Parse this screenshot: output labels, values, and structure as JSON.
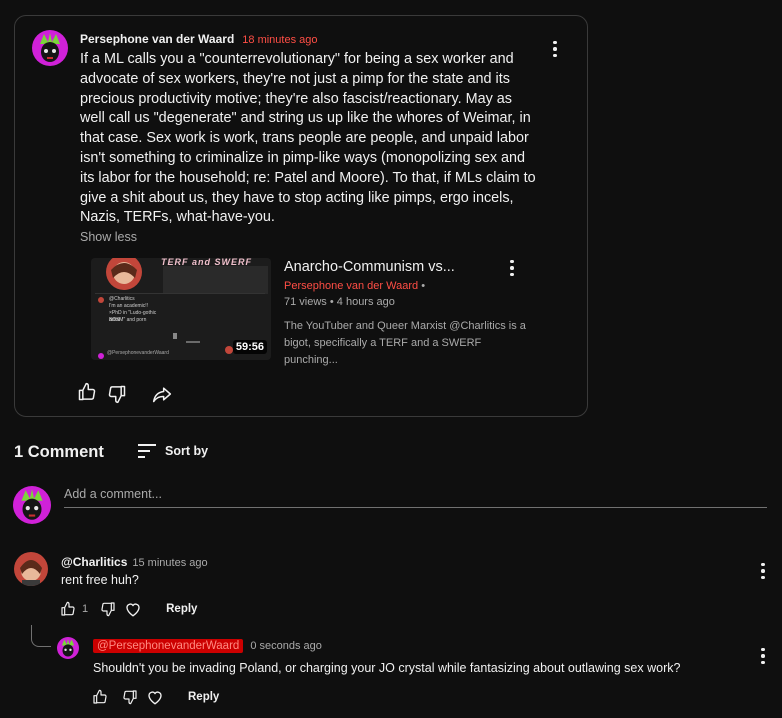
{
  "post": {
    "author": "Persephone van der Waard",
    "time": "18 minutes ago",
    "body": "If a ML calls you a \"counterrevolutionary\" for being a sex worker and advocate of sex workers, they're not just a pimp for the state and its precious productivity motive; they're also fascist/reactionary. May as well call us \"degenerate\" and string us up like the whores of Weimar, in that case. Sex work is work, trans people are people, and unpaid labor isn't something to criminalize in pimp-like ways (monopolizing sex and its labor for the household; re: Patel and Moore). To that, if MLs claim to give a shit about us, they have to stop acting like pimps, ergo incels, Nazis, TERFs, what-have-you.",
    "show_less": "Show less",
    "video": {
      "title": "Anarcho-Communism vs...",
      "channel": "Persephone van der Waard",
      "channel_suffix": "•",
      "views": "71 views",
      "age": "4 hours ago",
      "meta_sep": "•",
      "description": "The YouTuber and Queer Marxist @Charlitics is a bigot, specifically a TERF and a SWERF punching...",
      "duration": "59:56",
      "thumb_banner": "TERF and SWERF",
      "thumb_lines": [
        "@Charlitics",
        "I'm an academic!!",
        "×PhD in \"Ludo-gothic BDSM\" and porn",
        "artist",
        "@PersephonevanderWaard"
      ]
    }
  },
  "comments_header": {
    "count_label": "1 Comment",
    "sort_label": "Sort by"
  },
  "add_comment": {
    "placeholder": "Add a comment..."
  },
  "comments": [
    {
      "author": "@Charlitics",
      "time": "15 minutes ago",
      "text": "rent free huh?",
      "likes": "1",
      "reply_label": "Reply"
    }
  ],
  "reply": {
    "author": "@PersephonevanderWaard",
    "time": "0 seconds ago",
    "text": "Shouldn't you be invading Poland, or charging your JO crystal while fantasizing about outlawing sex work?",
    "reply_label": "Reply"
  },
  "colors": {
    "background": "#0f0f0f",
    "text": "#f1f1f1",
    "secondary": "#aaaaaa",
    "accent_red": "#ff4e45",
    "mention_bg": "#cc0000"
  },
  "icons": [
    "more-vert-icon",
    "thumb-up-icon",
    "thumb-down-icon",
    "share-icon",
    "sort-icon",
    "heart-icon"
  ]
}
